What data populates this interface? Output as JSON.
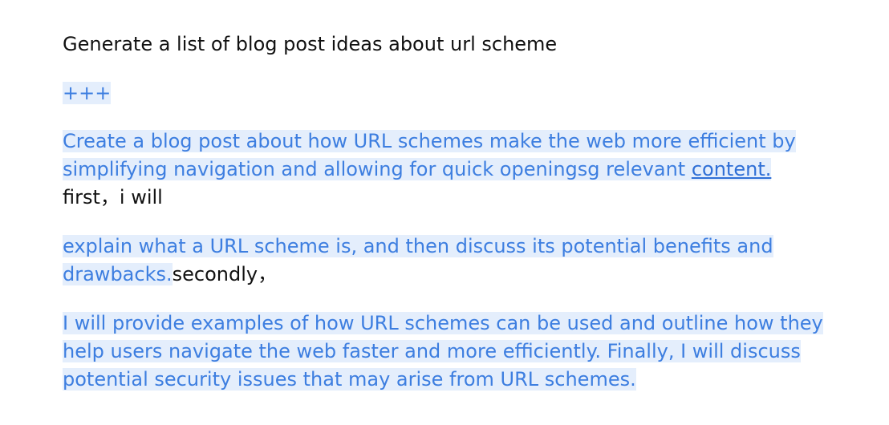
{
  "document": {
    "prompt": "Generate a list of blog post ideas about  url scheme",
    "separator": "+++",
    "paragraph_1": {
      "highlighted": "Create a blog post about how URL schemes make the web more efficient by simplifying navigation and allowing for quick openingsg relevant ",
      "link": "content. ",
      "plain": "first，i will"
    },
    "paragraph_2": {
      "highlighted": "explain what a URL scheme is, and then discuss its potential benefits and drawbacks.",
      "plain": "secondly，"
    },
    "paragraph_3": {
      "highlighted": "I will provide examples of how URL schemes can be used and outline how they help users navigate the web faster and more efficiently. Finally, I will discuss potential security issues that may arise from URL schemes."
    },
    "colors": {
      "highlight_text": "#3d7ee0",
      "highlight_background": "#e4eefc",
      "link": "#2f6fd6",
      "body_text": "#111111"
    }
  }
}
